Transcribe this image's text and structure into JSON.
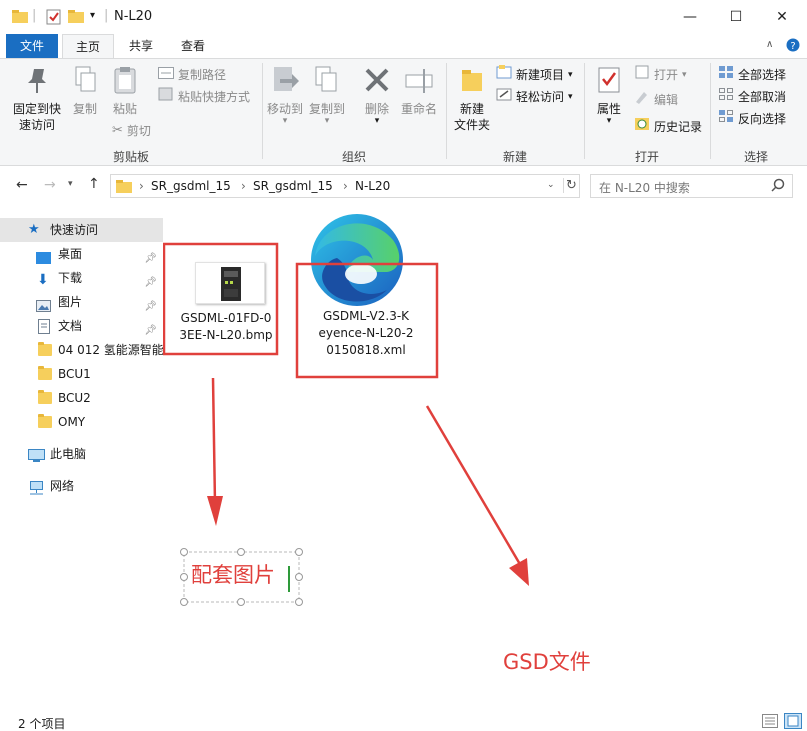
{
  "window": {
    "title": "N-L20",
    "qa_separator": "|",
    "controls": {
      "minimize": "—",
      "maximize": "☐",
      "close": "✕"
    }
  },
  "ribbon": {
    "tabs": [
      "文件",
      "主页",
      "共享",
      "查看"
    ],
    "clipboard": {
      "pin_label_1": "固定到快",
      "pin_label_2": "速访问",
      "copy": "复制",
      "paste": "粘贴",
      "copy_path": "复制路径",
      "paste_shortcut": "粘贴快捷方式",
      "cut": "剪切",
      "group": "剪贴板"
    },
    "organize": {
      "move_to": "移动到",
      "copy_to": "复制到",
      "delete": "删除",
      "rename": "重命名",
      "group": "组织"
    },
    "new": {
      "new_folder_1": "新建",
      "new_folder_2": "文件夹",
      "new_item": "新建项目",
      "easy_access": "轻松访问",
      "group": "新建"
    },
    "open": {
      "properties": "属性",
      "open": "打开",
      "edit": "编辑",
      "history": "历史记录",
      "group": "打开"
    },
    "select": {
      "select_all": "全部选择",
      "select_none": "全部取消",
      "invert": "反向选择",
      "group": "选择"
    }
  },
  "address": {
    "crumbs": [
      "SR_gsdml_15",
      "SR_gsdml_15",
      "N-L20"
    ],
    "search_placeholder": "在 N-L20 中搜索"
  },
  "sidebar": {
    "quick_access": "快速访问",
    "items": [
      "桌面",
      "下载",
      "图片",
      "文档",
      "04 012 氢能源智能",
      "BCU1",
      "BCU2",
      "OMY"
    ],
    "this_pc": "此电脑",
    "network": "网络"
  },
  "files": [
    {
      "name_line1": "GSDML-01FD-0",
      "name_line2": "3EE-N-L20.bmp"
    },
    {
      "name_line1": "GSDML-V2.3-K",
      "name_line2": "eyence-N-L20-2",
      "name_line3": "0150818.xml"
    }
  ],
  "annotations": {
    "image_label": "配套图片",
    "gsd_label": "GSD文件",
    "color": "#e0403c"
  },
  "status": {
    "count": "2 个项目"
  }
}
